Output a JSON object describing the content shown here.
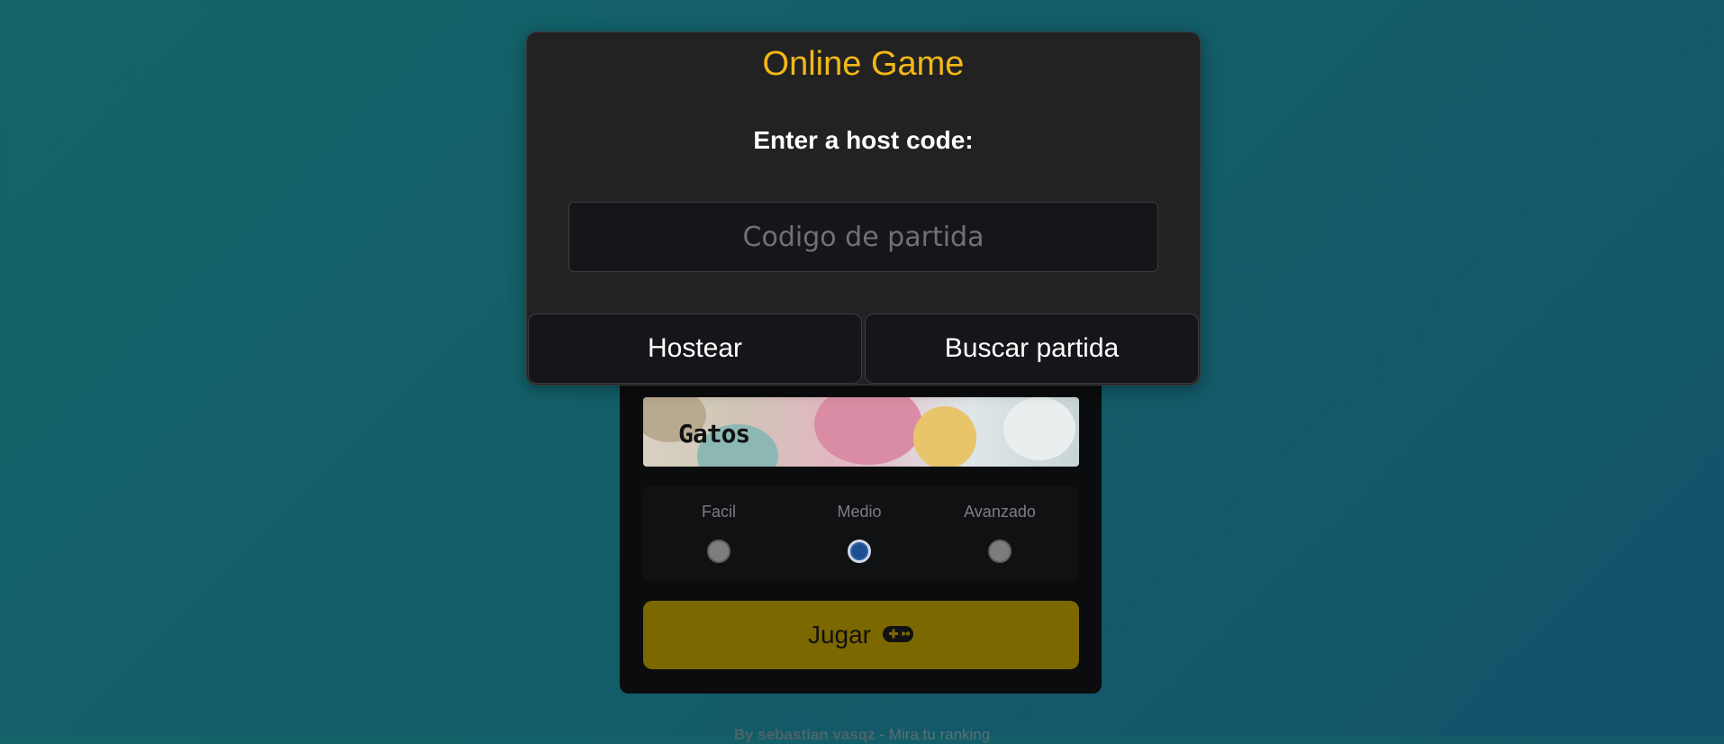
{
  "modal": {
    "title": "Online Game",
    "prompt": "Enter a host code:",
    "code_placeholder": "Codigo de partida",
    "host_label": "Hostear",
    "find_label": "Buscar partida"
  },
  "game": {
    "category_label": "Gatos",
    "difficulties": [
      {
        "label": "Facil",
        "selected": false
      },
      {
        "label": "Medio",
        "selected": true
      },
      {
        "label": "Avanzado",
        "selected": false
      }
    ],
    "play_label": "Jugar",
    "play_icon": "gamepad-icon"
  },
  "footer": {
    "author": "By sebastian vasqz",
    "separator": "-",
    "ranking_link": "Mira tu ranking"
  },
  "colors": {
    "accent": "#f3b816",
    "play_button": "#7c6800",
    "radio_selected": "#1a4f91"
  }
}
